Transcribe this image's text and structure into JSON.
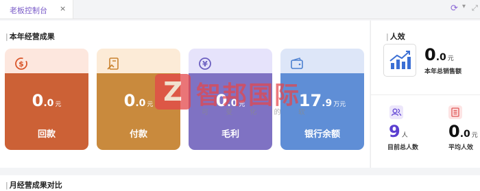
{
  "tabs": [
    {
      "label": "老板控制台",
      "close": "×"
    }
  ],
  "toolbar": {
    "refresh_icon": "refresh-icon",
    "chevron_icon": "chevron-down-icon",
    "expand_icon": "expand-icon"
  },
  "section_main": {
    "bar": "|",
    "title": "本年经营成果"
  },
  "cards": [
    {
      "integer": "0",
      "decimal": ".0",
      "unit": "元",
      "label": "回款",
      "icon": "dollar-circle-icon",
      "top_color": "#fde7de",
      "bottom_color": "#cc6136",
      "icon_color": "#d9562a"
    },
    {
      "integer": "0",
      "decimal": ".0",
      "unit": "元",
      "label": "付款",
      "icon": "payment-icon",
      "top_color": "#fcebd7",
      "bottom_color": "#c98a3d",
      "icon_color": "#c9822e"
    },
    {
      "integer": "0",
      "decimal": ".0",
      "unit": "元",
      "label": "毛利",
      "icon": "yen-circle-icon",
      "top_color": "#e6e3fb",
      "bottom_color": "#7f72c3",
      "icon_color": "#6b5fc0"
    },
    {
      "integer": "17",
      "decimal": ".9",
      "unit": "万元",
      "label": "银行余额",
      "icon": "wallet-icon",
      "top_color": "#dde6f8",
      "bottom_color": "#5f8ed6",
      "icon_color": "#4a7fd0"
    }
  ],
  "watermark": {
    "logo_letter": "Z",
    "text": "智邦国际",
    "sub": "可 变 化 的 软"
  },
  "side": {
    "title_bar": "|",
    "title": "人效",
    "total": {
      "integer": "0",
      "decimal": ".0",
      "unit": "元",
      "label": "本年总销售额",
      "icon": "trend-chart-icon"
    },
    "stats": [
      {
        "integer": "9",
        "decimal": "",
        "unit": "人",
        "label": "目前总人数",
        "icon": "users-icon",
        "color": "#5b3fd0",
        "icon_bg": "#ece6fb"
      },
      {
        "integer": "0",
        "decimal": ".0",
        "unit": "元",
        "label": "平均人效",
        "icon": "list-icon",
        "color": "#111111",
        "icon_bg": "#fde4e4"
      }
    ]
  },
  "section_bottom": {
    "bar": "|",
    "title": "月经营成果对比"
  }
}
